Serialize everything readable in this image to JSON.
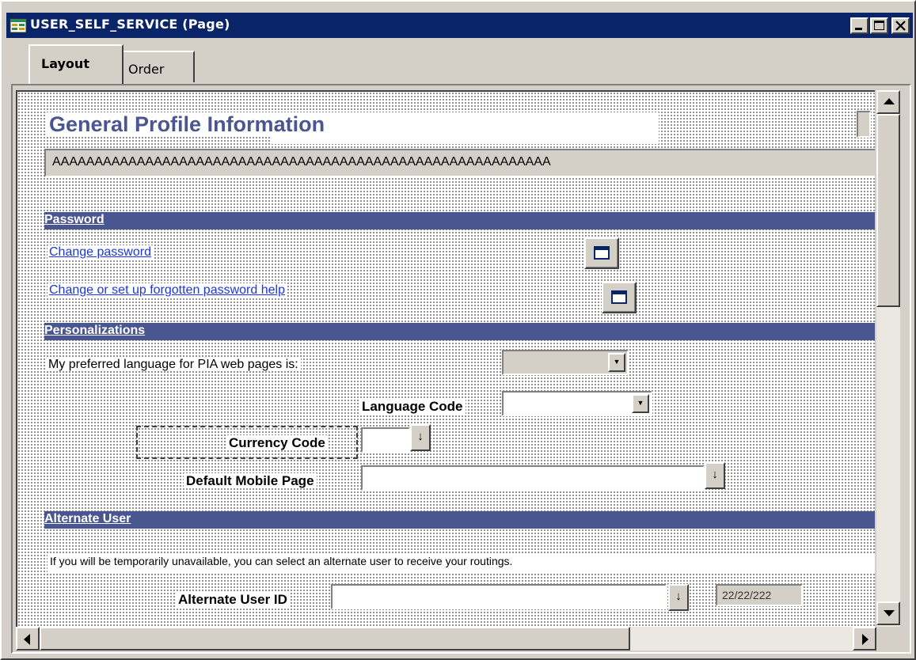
{
  "window": {
    "title": "USER_SELF_SERVICE (Page)",
    "controls": [
      "minimize-icon",
      "maximize-icon",
      "close-icon"
    ]
  },
  "tabs": [
    {
      "label": "Layout",
      "active": true
    },
    {
      "label": "Order",
      "active": false
    }
  ],
  "page": {
    "title": "General Profile Information",
    "placeholder_field": "AAAAAAAAAAAAAAAAAAAAAAAAAAAAAAAAAAAAAAAAAAAAAAAAAAAAAAAAAAA",
    "sections": {
      "password": "Password",
      "personalizations": "Personalizations",
      "alternate_user": "Alternate User"
    },
    "links": {
      "change_password": "Change password",
      "forgotten_help": "Change or set up forgotten password help"
    },
    "labels": {
      "preferred_language": "My preferred language for PIA web pages is:",
      "language_code": "Language Code",
      "currency_code": "Currency Code",
      "default_mobile_page": "Default Mobile Page",
      "alternate_info": "If you will be temporarily unavailable, you can select an alternate user to receive your routings.",
      "alternate_user_id": "Alternate User ID"
    },
    "date_field": "22/22/222"
  },
  "colors": {
    "titlebar": "#0a246a",
    "section_bar": "#4a5690",
    "link": "#1a36e8",
    "chrome": "#d4d0c8"
  }
}
